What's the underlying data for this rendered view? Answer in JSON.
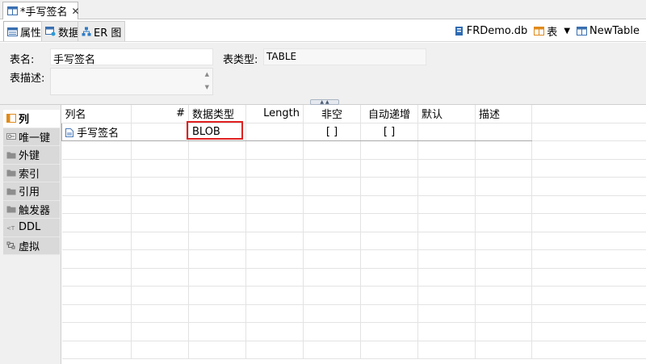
{
  "editor_tab": {
    "title": "*手写签名",
    "close": "✕",
    "icon": "table-icon"
  },
  "sub_tabs": [
    {
      "label": "属性",
      "icon": "properties-icon"
    },
    {
      "label": "数据",
      "icon": "data-icon"
    },
    {
      "label": "ER 图",
      "icon": "er-diagram-icon"
    }
  ],
  "toolbar": {
    "database": "FRDemo.db",
    "object_type": "表",
    "dropdown": "▼",
    "new_table": "NewTable"
  },
  "properties": {
    "table_name_label": "表名:",
    "table_name_value": "手写签名",
    "table_type_label": "表类型:",
    "table_type_value": "TABLE",
    "table_desc_label": "表描述:",
    "table_desc_value": ""
  },
  "side_nav": [
    {
      "label": "列",
      "icon": "columns-icon"
    },
    {
      "label": "唯一键",
      "icon": "unique-key-icon"
    },
    {
      "label": "外键",
      "icon": "folder-icon"
    },
    {
      "label": "索引",
      "icon": "folder-icon"
    },
    {
      "label": "引用",
      "icon": "folder-icon"
    },
    {
      "label": "触发器",
      "icon": "folder-icon"
    },
    {
      "label": "DDL",
      "icon": "ddl-icon"
    },
    {
      "label": "虚拟",
      "icon": "virtual-icon"
    }
  ],
  "grid": {
    "headers": [
      "列名",
      "#",
      "数据类型",
      "Length",
      "非空",
      "自动递增",
      "默认",
      "描述"
    ],
    "rows": [
      {
        "name": "手写签名",
        "index": "",
        "type": "BLOB",
        "length": "",
        "not_null": "[ ]",
        "auto_inc": "[ ]",
        "default": "",
        "desc": ""
      }
    ]
  },
  "colors": {
    "highlight": "#e02020",
    "active_bg": "#ffffff",
    "panel_bg": "#f0f0f0"
  }
}
